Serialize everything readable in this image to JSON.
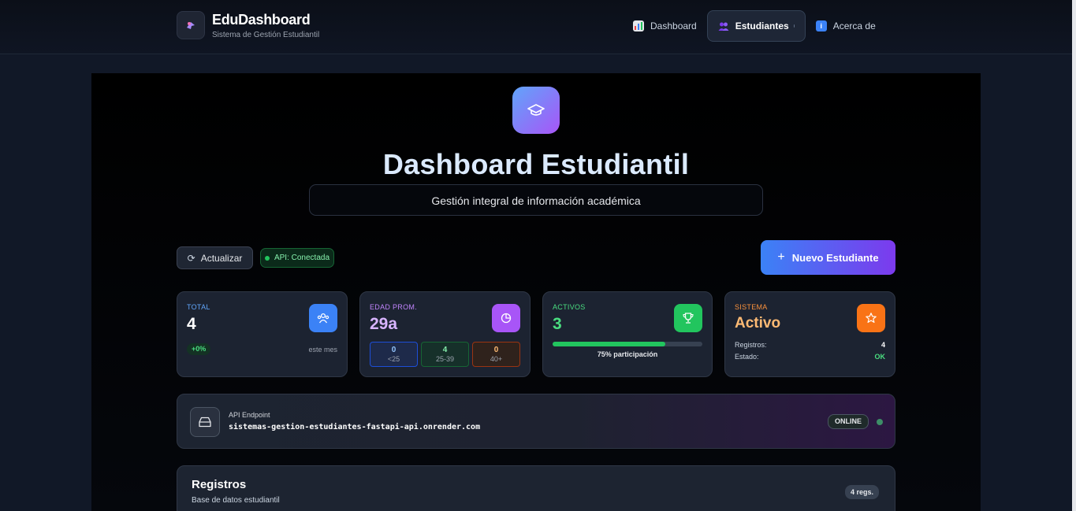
{
  "header": {
    "brand_title": "EduDashboard",
    "brand_subtitle": "Sistema de Gestión Estudiantil",
    "nav": [
      {
        "label": "Dashboard",
        "icon": "bar-chart-icon"
      },
      {
        "label": "Estudiantes",
        "icon": "users-icon",
        "active": true
      },
      {
        "label": "Acerca de",
        "icon": "info-icon"
      }
    ]
  },
  "hero": {
    "title": "Dashboard Estudiantil",
    "subtitle": "Gestión integral de información académica"
  },
  "actions": {
    "refresh_label": "Actualizar",
    "api_status": "API: Conectada",
    "new_student_label": "Nuevo Estudiante"
  },
  "cards": {
    "total": {
      "label": "TOTAL",
      "value": "4",
      "change": "+0%",
      "note": "este mes"
    },
    "age": {
      "label": "EDAD PROM.",
      "value": "29a",
      "buckets": [
        {
          "count": "0",
          "range": "<25"
        },
        {
          "count": "4",
          "range": "25-39"
        },
        {
          "count": "0",
          "range": "40+"
        }
      ]
    },
    "active": {
      "label": "ACTIVOS",
      "value": "3",
      "participation": 0.75,
      "participation_text": "75% participación"
    },
    "system": {
      "label": "SISTEMA",
      "value": "Activo",
      "records_label": "Registros:",
      "records_value": "4",
      "state_label": "Estado:",
      "state_value": "OK"
    }
  },
  "endpoint": {
    "label": "API Endpoint",
    "url": "sistemas-gestion-estudiantes-fastapi-api.onrender.com",
    "status": "ONLINE"
  },
  "records": {
    "title": "Registros",
    "subtitle": "Base de datos estudiantil",
    "count_badge": "4 regs."
  },
  "colors": {
    "accent_blue": "#3b82f6",
    "accent_purple": "#a855f7",
    "success": "#22c55e",
    "warning": "#f97316"
  }
}
